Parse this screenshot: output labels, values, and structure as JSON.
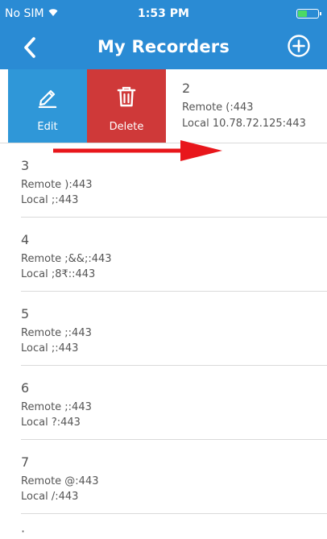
{
  "status_bar": {
    "carrier": "No SIM",
    "time": "1:53 PM",
    "wifi_icon": "wifi-icon",
    "battery_icon": "battery-icon"
  },
  "header": {
    "title": "My Recorders",
    "back_icon": "chevron-left-icon",
    "add_icon": "plus-circle-icon",
    "color": "#2a8bd4"
  },
  "swipe_actions": {
    "edit": {
      "label": "Edit",
      "icon": "pencil-icon",
      "color": "#2f97d8"
    },
    "delete": {
      "label": "Delete",
      "icon": "trash-icon",
      "color": "#cf3939"
    }
  },
  "recorders": [
    {
      "name": "2",
      "remote": "Remote (:443",
      "local": "Local  10.78.72.125:443"
    },
    {
      "name": "3",
      "remote": "Remote ):443",
      "local": "Local  ;:443"
    },
    {
      "name": "4",
      "remote": "Remote ;&&;:443",
      "local": "Local  ;8₹::443"
    },
    {
      "name": "5",
      "remote": "Remote ;:443",
      "local": "Local  ;:443"
    },
    {
      "name": "6",
      "remote": "Remote ;:443",
      "local": "Local  ?:443"
    },
    {
      "name": "7",
      "remote": "Remote @:443",
      "local": "Local  /:443"
    }
  ],
  "annotation": {
    "swipe_arrow_color": "#e8161b"
  }
}
